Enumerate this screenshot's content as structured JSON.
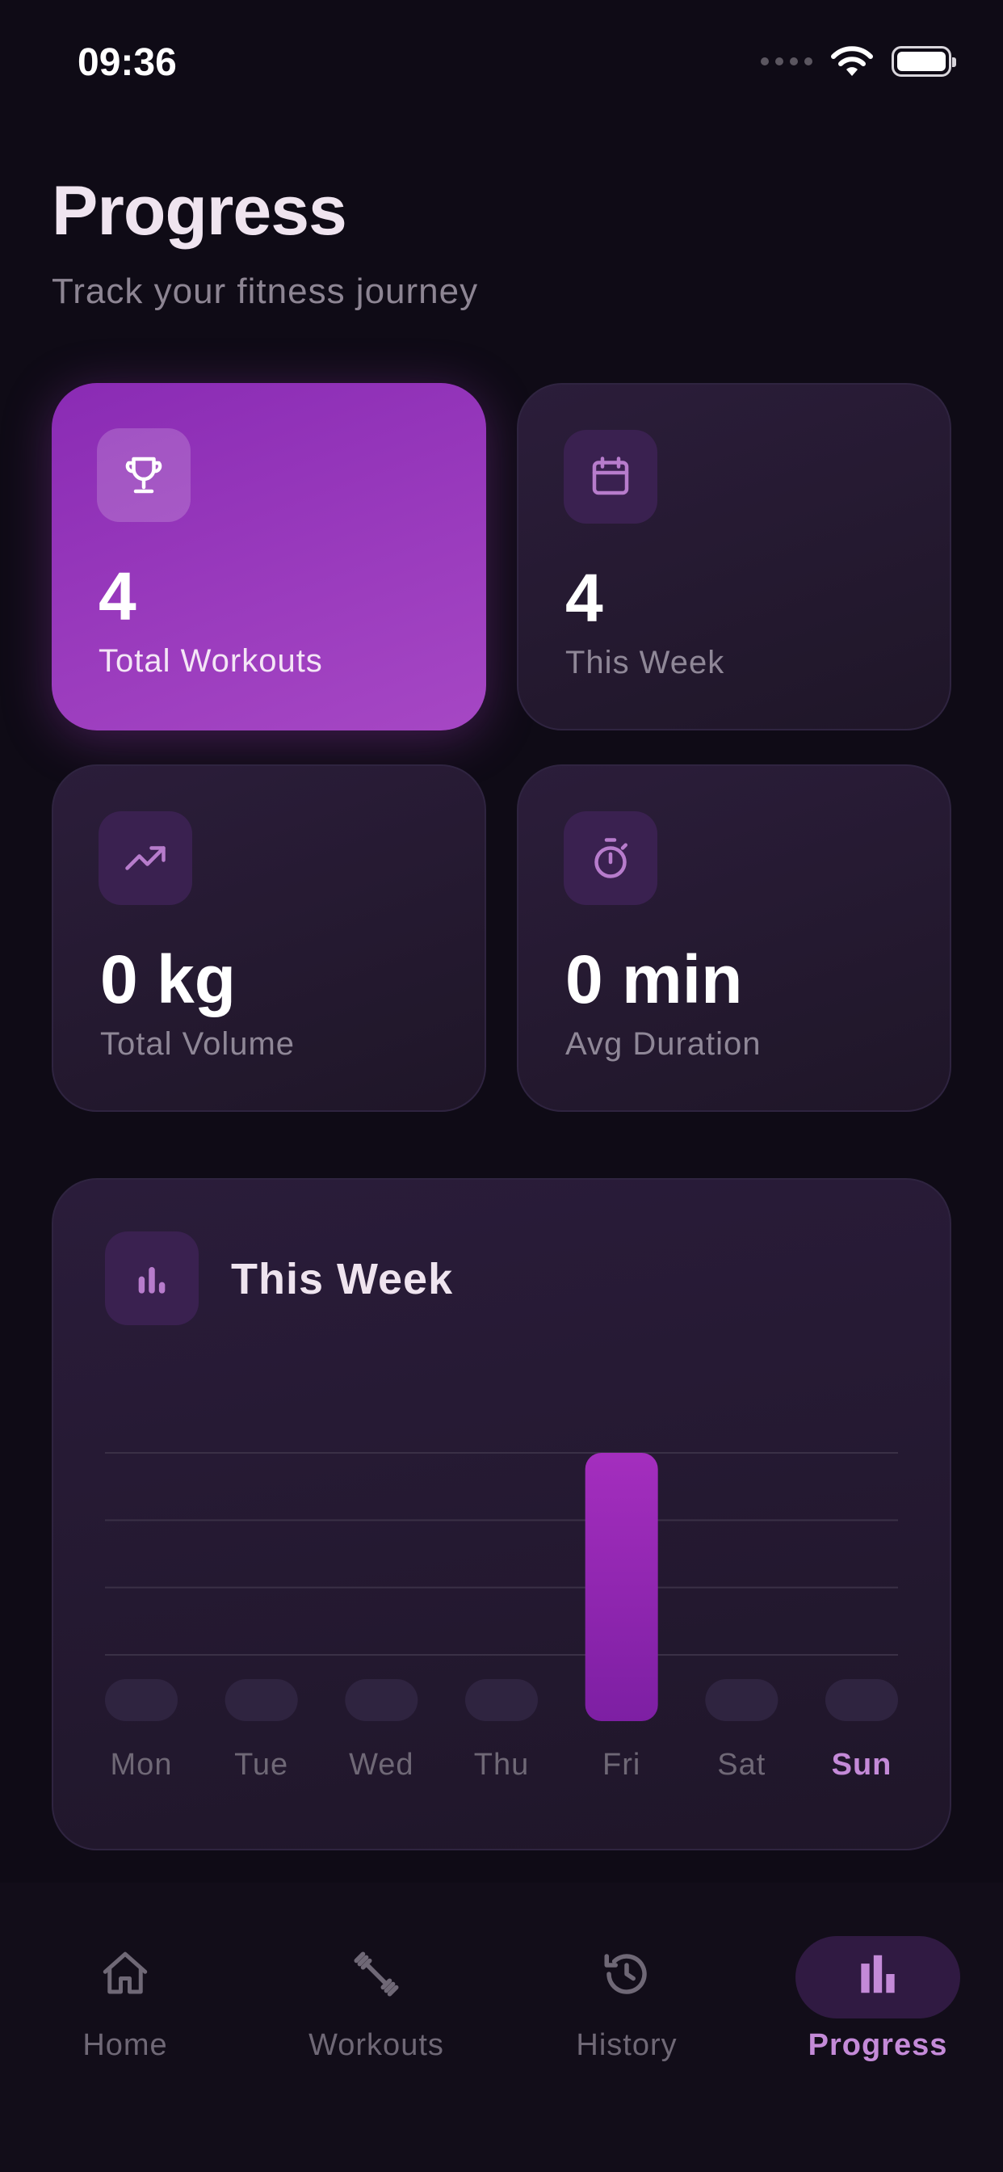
{
  "status_bar": {
    "time": "09:36"
  },
  "header": {
    "title": "Progress",
    "subtitle": "Track your fitness journey"
  },
  "stats": [
    {
      "icon": "trophy-icon",
      "value": "4",
      "label": "Total Workouts",
      "active": true
    },
    {
      "icon": "calendar-icon",
      "value": "4",
      "label": "This Week",
      "active": false
    },
    {
      "icon": "trending-up-icon",
      "value": "0 kg",
      "label": "Total Volume",
      "active": false
    },
    {
      "icon": "stopwatch-icon",
      "value": "0 min",
      "label": "Avg Duration",
      "active": false
    }
  ],
  "weekly_chart": {
    "title": "This Week",
    "icon": "bar-chart-icon",
    "today": "Sun",
    "colors": {
      "bar": "#9b2ab8",
      "bar_empty": "#2f2440",
      "today_label": "#c48ad8",
      "label": "#6f6876",
      "grid": "#3a3046"
    }
  },
  "chart_data": {
    "type": "bar",
    "title": "This Week",
    "categories": [
      "Mon",
      "Tue",
      "Wed",
      "Thu",
      "Fri",
      "Sat",
      "Sun"
    ],
    "values": [
      0,
      0,
      0,
      0,
      4,
      0,
      0
    ],
    "ylim": [
      0,
      4
    ],
    "grid": true
  },
  "nav": {
    "items": [
      {
        "label": "Home",
        "icon": "home-icon",
        "active": false
      },
      {
        "label": "Workouts",
        "icon": "dumbbell-icon",
        "active": false
      },
      {
        "label": "History",
        "icon": "history-icon",
        "active": false
      },
      {
        "label": "Progress",
        "icon": "bar-chart-icon",
        "active": true
      }
    ]
  },
  "colors": {
    "background": "#0f0b16",
    "accent": "#a647c4",
    "accent_light": "#c48ad8"
  }
}
